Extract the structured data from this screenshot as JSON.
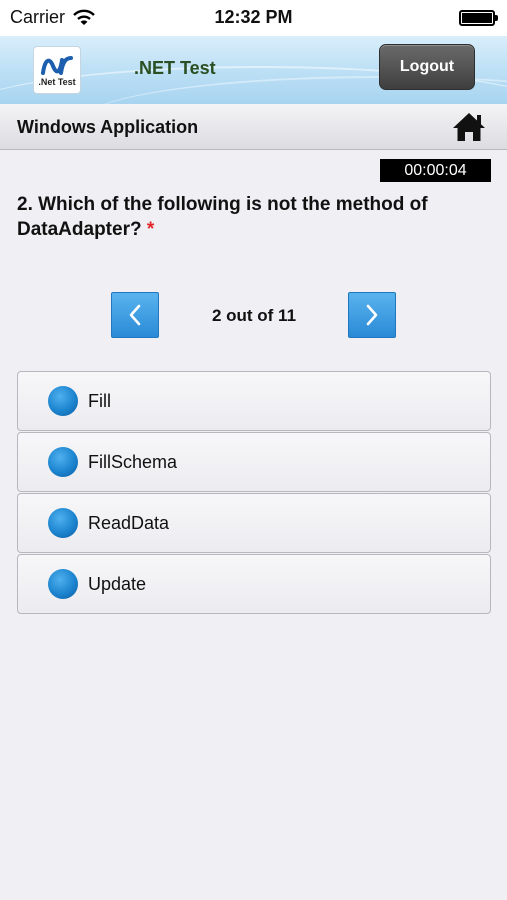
{
  "status_bar": {
    "carrier": "Carrier",
    "time": "12:32 PM"
  },
  "header": {
    "logo_text": ".Net Test",
    "title": ".NET Test",
    "logout_label": "Logout"
  },
  "section": {
    "title": "Windows Application",
    "home_icon": "home-icon"
  },
  "timer": "00:00:04",
  "question": {
    "text": "2. Which of the following is not the method of DataAdapter?",
    "required_mark": "*"
  },
  "pager": {
    "text": "2 out of 11",
    "prev_icon": "chevron-left-icon",
    "next_icon": "chevron-right-icon"
  },
  "options": [
    {
      "label": "Fill"
    },
    {
      "label": "FillSchema"
    },
    {
      "label": "ReadData"
    },
    {
      "label": "Update"
    }
  ],
  "colors": {
    "accent_blue": "#2a8ad6",
    "header_title_green": "#2a4f22",
    "required_red": "#e3262a"
  }
}
